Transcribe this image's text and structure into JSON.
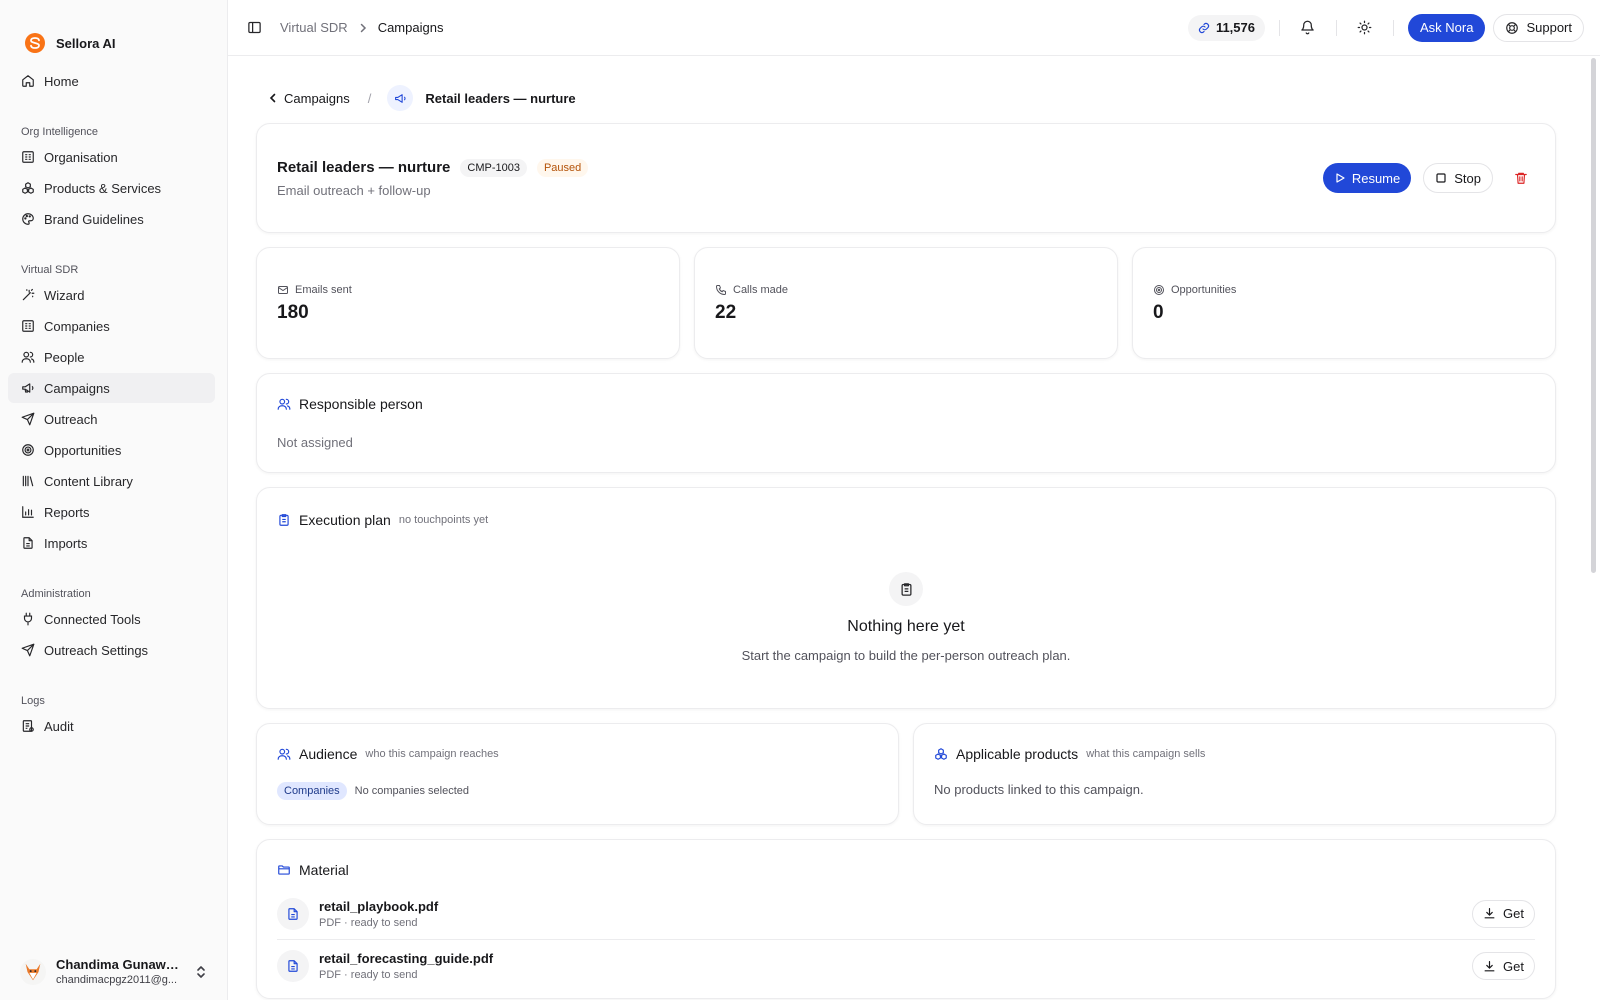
{
  "brand": {
    "name": "Sellora AI"
  },
  "sidebar": {
    "home": "Home",
    "groups": [
      {
        "title": "Org Intelligence",
        "items": [
          {
            "label": "Organisation",
            "icon": "building-icon"
          },
          {
            "label": "Products & Services",
            "icon": "boxes-icon"
          },
          {
            "label": "Brand Guidelines",
            "icon": "palette-icon"
          }
        ]
      },
      {
        "title": "Virtual SDR",
        "items": [
          {
            "label": "Wizard",
            "icon": "magic-wand-icon"
          },
          {
            "label": "Companies",
            "icon": "building-icon"
          },
          {
            "label": "People",
            "icon": "users-icon"
          },
          {
            "label": "Campaigns",
            "icon": "megaphone-icon",
            "active": true
          },
          {
            "label": "Outreach",
            "icon": "send-icon"
          },
          {
            "label": "Opportunities",
            "icon": "target-icon"
          },
          {
            "label": "Content Library",
            "icon": "library-icon"
          },
          {
            "label": "Reports",
            "icon": "bar-chart-icon"
          },
          {
            "label": "Imports",
            "icon": "file-icon"
          }
        ]
      },
      {
        "title": "Administration",
        "items": [
          {
            "label": "Connected Tools",
            "icon": "plug-icon"
          },
          {
            "label": "Outreach Settings",
            "icon": "send-icon"
          }
        ]
      },
      {
        "title": "Logs",
        "items": [
          {
            "label": "Audit",
            "icon": "audit-log-icon"
          }
        ]
      }
    ],
    "user": {
      "name": "Chandima Gunawar...",
      "email": "chandimacpgz2011@g..."
    }
  },
  "topbar": {
    "breadcrumb": [
      "Virtual SDR",
      "Campaigns"
    ],
    "credits": "11,576",
    "ask_label": "Ask Nora",
    "support_label": "Support"
  },
  "page": {
    "back_label": "Campaigns",
    "crumb_title": "Retail leaders — nurture",
    "campaign": {
      "title": "Retail leaders — nurture",
      "id": "CMP-1003",
      "status": "Paused",
      "subtitle": "Email outreach + follow-up",
      "resume_label": "Resume",
      "stop_label": "Stop"
    },
    "stats": [
      {
        "label": "Emails sent",
        "value": "180",
        "icon": "mail-icon"
      },
      {
        "label": "Calls made",
        "value": "22",
        "icon": "phone-icon"
      },
      {
        "label": "Opportunities",
        "value": "0",
        "icon": "target-icon"
      }
    ],
    "responsible": {
      "title": "Responsible person",
      "value": "Not assigned"
    },
    "execution": {
      "title": "Execution plan",
      "note": "no touchpoints yet",
      "empty_title": "Nothing here yet",
      "empty_text": "Start the campaign to build the per-person outreach plan."
    },
    "audience": {
      "title": "Audience",
      "note": "who this campaign reaches",
      "tag": "Companies",
      "value": "No companies selected"
    },
    "products": {
      "title": "Applicable products",
      "note": "what this campaign sells",
      "value": "No products linked to this campaign."
    },
    "material": {
      "title": "Material",
      "get_label": "Get",
      "files": [
        {
          "name": "retail_playbook.pdf",
          "meta": "PDF · ready to send"
        },
        {
          "name": "retail_forecasting_guide.pdf",
          "meta": "PDF · ready to send"
        }
      ]
    }
  },
  "colors": {
    "accent": "#2148d8",
    "paused": "#b45309",
    "danger": "#dc2626",
    "brand": "#f97316"
  }
}
